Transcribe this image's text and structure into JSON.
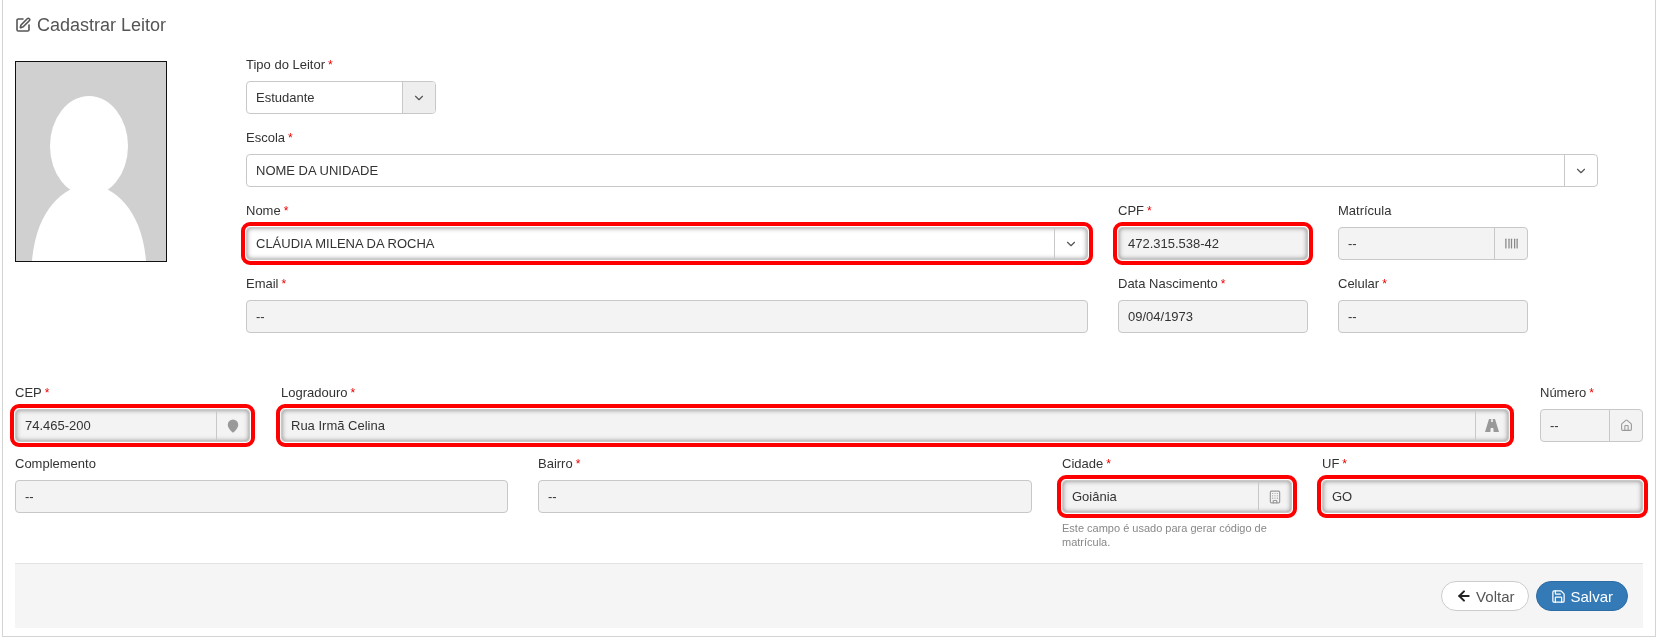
{
  "title": "Cadastrar Leitor",
  "top_fields": {
    "tipo_leitor": {
      "label": "Tipo do Leitor",
      "asterisk": "*",
      "value": "Estudante",
      "disabled": false,
      "highlighted": false
    },
    "escola": {
      "label": "Escola",
      "asterisk": "*",
      "value": "NOME DA UNIDADE",
      "disabled": false,
      "highlighted": false
    },
    "nome": {
      "label": "Nome",
      "asterisk": "*",
      "value": "CLÁUDIA MILENA DA ROCHA",
      "disabled": false,
      "highlighted": true
    },
    "cpf": {
      "label": "CPF",
      "asterisk": "*",
      "value": "472.315.538-42",
      "disabled": true,
      "highlighted": true
    },
    "matricula": {
      "label": "Matrícula",
      "value": "--",
      "disabled": true,
      "highlighted": false
    },
    "email": {
      "label": "Email",
      "asterisk": "*",
      "value": "--",
      "disabled": true,
      "highlighted": false
    },
    "data_nascimento": {
      "label": "Data Nascimento",
      "asterisk": "*",
      "value": "09/04/1973",
      "disabled": true,
      "highlighted": false
    },
    "celular": {
      "label": "Celular",
      "asterisk": "*",
      "value": "--",
      "disabled": true,
      "highlighted": false
    }
  },
  "address_fields": {
    "cep": {
      "label": "CEP",
      "asterisk": "*",
      "value": "74.465-200",
      "disabled": true,
      "highlighted": true
    },
    "logradouro": {
      "label": "Logradouro",
      "asterisk": "*",
      "value": "Rua Irmã Celina",
      "disabled": true,
      "highlighted": true
    },
    "numero": {
      "label": "Número",
      "asterisk": "*",
      "value": "--",
      "disabled": true,
      "highlighted": false
    },
    "complemento": {
      "label": "Complemento",
      "value": "--",
      "disabled": true,
      "highlighted": false
    },
    "bairro": {
      "label": "Bairro",
      "asterisk": "*",
      "value": "--",
      "disabled": true,
      "highlighted": false
    },
    "cidade": {
      "label": "Cidade",
      "asterisk": "*",
      "value": "Goiânia",
      "disabled": true,
      "highlighted": true,
      "help": "Este campo é usado para gerar código de matrícula."
    },
    "uf": {
      "label": "UF",
      "asterisk": "*",
      "value": "GO",
      "disabled": true,
      "highlighted": true
    }
  },
  "buttons": {
    "back": "Voltar",
    "save": "Salvar"
  }
}
